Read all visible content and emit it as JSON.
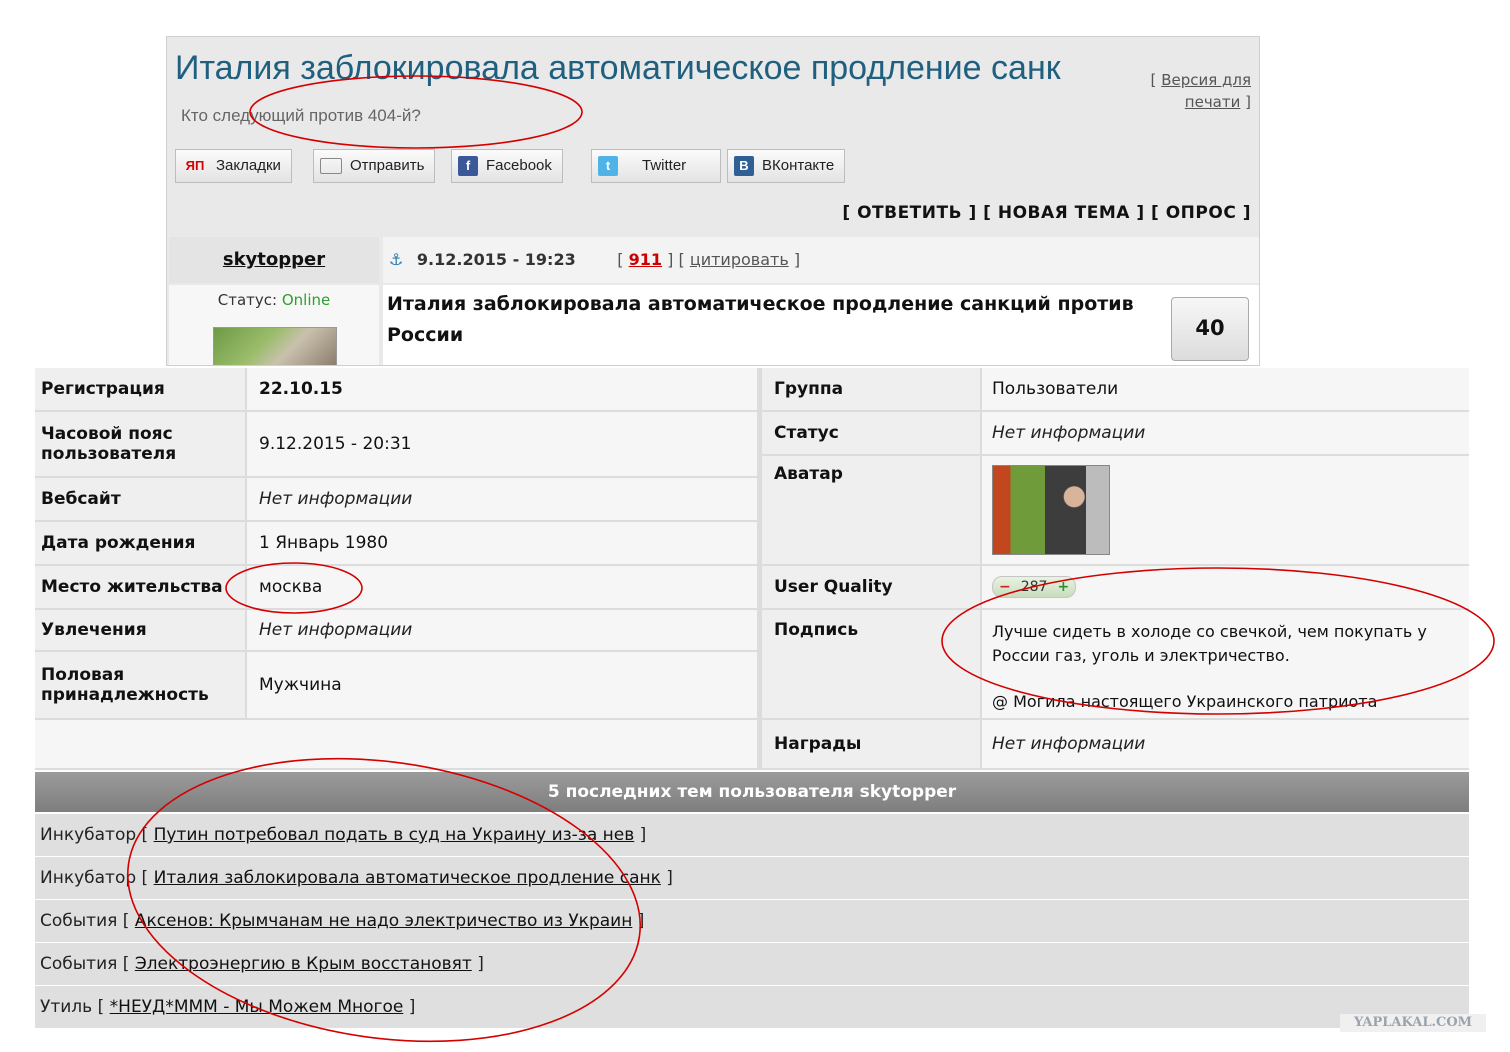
{
  "topic": {
    "title": "Италия заблокировала автоматическое продление санк",
    "subtitle": "Кто следующий против 404-й?",
    "print_open": "[",
    "print_link": "Версия для печати",
    "print_close": "]"
  },
  "share": {
    "bookmarks": "Закладки",
    "send": "Отправить",
    "facebook": "Facebook",
    "twitter": "Twitter",
    "vk": "ВКонтакте",
    "ya_icon": "ЯП"
  },
  "actions": "[ ОТВЕТИТЬ ] [ НОВАЯ ТЕМА ] [ ОПРОС ]",
  "post": {
    "author": "skytopper",
    "anchor_icon": "⚓",
    "datetime": "9.12.2015 - 19:23",
    "num_open": "[",
    "number": "911",
    "num_sep": "] [",
    "quote": "цитировать",
    "quote_close": "]",
    "status_label": "Статус:",
    "status_value": "Online",
    "title": "Италия заблокировала автоматическое продление санкций против России",
    "rating": "40"
  },
  "profile": {
    "left": [
      {
        "label": "Регистрация",
        "value": "22.10.15"
      },
      {
        "label": "Часовой пояс пользователя",
        "value": "9.12.2015 - 20:31"
      },
      {
        "label": "Вебсайт",
        "value": "Нет информации"
      },
      {
        "label": "Дата рождения",
        "value": "1 Январь 1980"
      },
      {
        "label": "Место жительства",
        "value": "москва"
      },
      {
        "label": "Увлечения",
        "value": "Нет информации"
      },
      {
        "label": "Половая принадлежность",
        "value": "Мужчина"
      }
    ],
    "right": {
      "group_label": "Группа",
      "group_value": "Пользователи",
      "status_label": "Статус",
      "status_value": "Нет информации",
      "avatar_label": "Аватар",
      "uq_label": "User Quality",
      "uq_minus": "−",
      "uq_value": "287",
      "uq_plus": "+",
      "signature_label": "Подпись",
      "signature_text": "Лучше сидеть в холоде со свечкой, чем покупать у России газ, уголь и электричество.",
      "signature_author": "@ Могила настоящего Украинского патриота",
      "awards_label": "Награды",
      "awards_value": "Нет информации"
    }
  },
  "topics": {
    "header": "5 последних тем пользователя skytopper",
    "rows": [
      {
        "section": "Инкубатор",
        "title": "Путин потребовал подать в суд на Украину из-за нев"
      },
      {
        "section": "Инкубатор",
        "title": "Италия заблокировала автоматическое продление санк"
      },
      {
        "section": "События",
        "title": "Аксенов: Крымчанам не надо электричество из Украин"
      },
      {
        "section": "События",
        "title": "Электроэнергию в Крым восстановят"
      },
      {
        "section": "Утиль",
        "title": "*НЕУД*МММ - Мы Можем Многое"
      }
    ]
  },
  "watermark": "YAPLAKAL.COM",
  "colors": {
    "title": "#1f5f7f",
    "online": "#2e9e2e",
    "oval": "#d40000",
    "number": "#cc0000"
  }
}
